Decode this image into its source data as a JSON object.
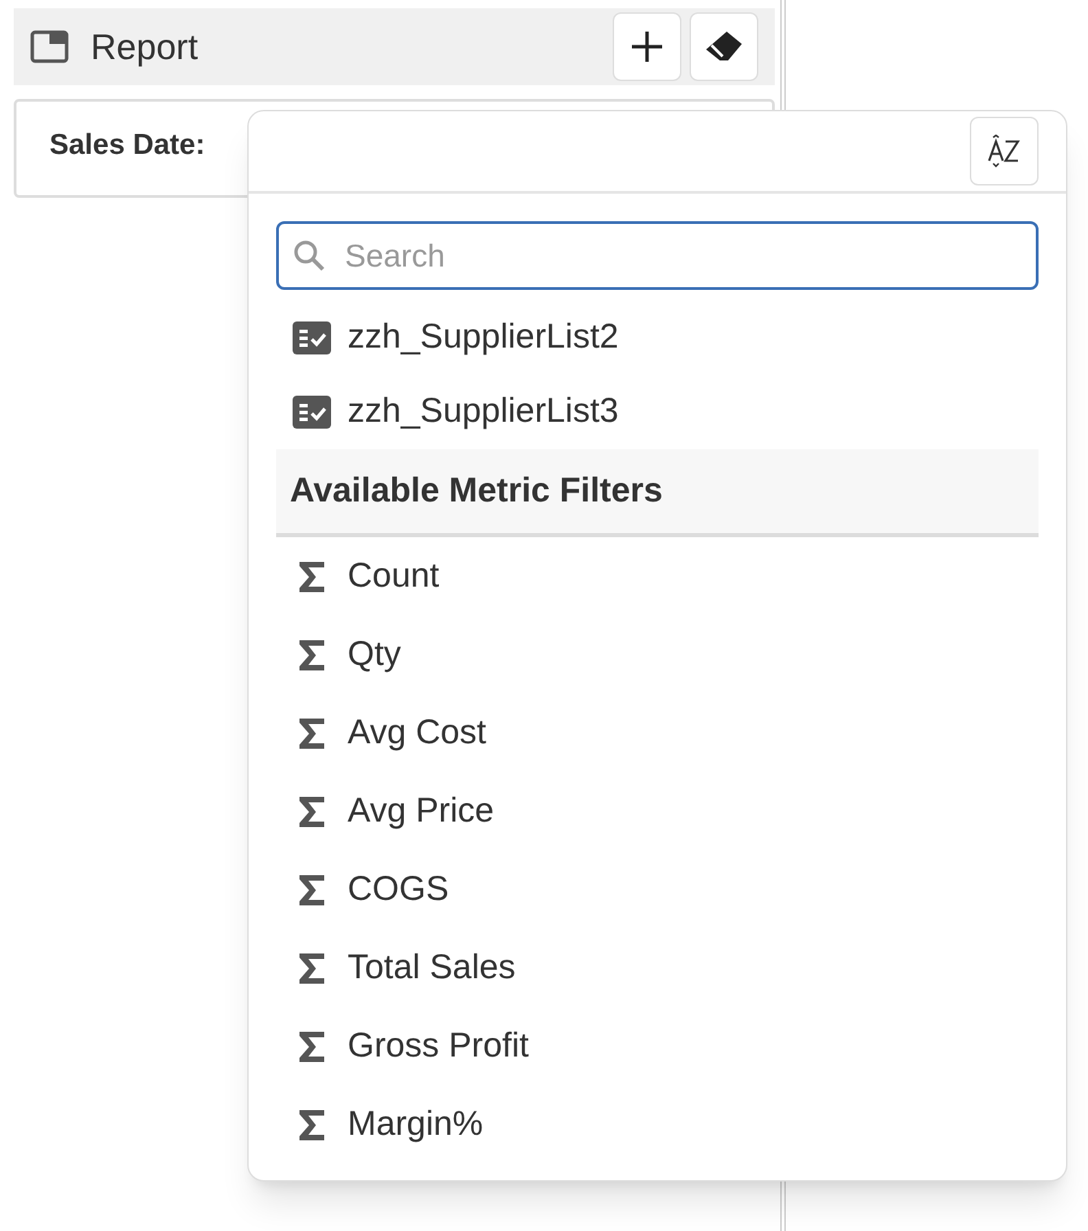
{
  "panel": {
    "title": "Report"
  },
  "filter_card": {
    "label": "Sales Date:"
  },
  "search": {
    "placeholder": "Search"
  },
  "list": [
    {
      "kind": "list",
      "label": "zzh_SupplierList2"
    },
    {
      "kind": "list",
      "label": "zzh_SupplierList3"
    },
    {
      "kind": "header",
      "label": "Available Metric Filters"
    },
    {
      "kind": "metric",
      "label": "Count"
    },
    {
      "kind": "metric",
      "label": "Qty"
    },
    {
      "kind": "metric",
      "label": "Avg Cost"
    },
    {
      "kind": "metric",
      "label": "Avg Price"
    },
    {
      "kind": "metric",
      "label": "COGS"
    },
    {
      "kind": "metric",
      "label": "Total Sales"
    },
    {
      "kind": "metric",
      "label": "Gross Profit"
    },
    {
      "kind": "metric",
      "label": "Margin%"
    }
  ]
}
